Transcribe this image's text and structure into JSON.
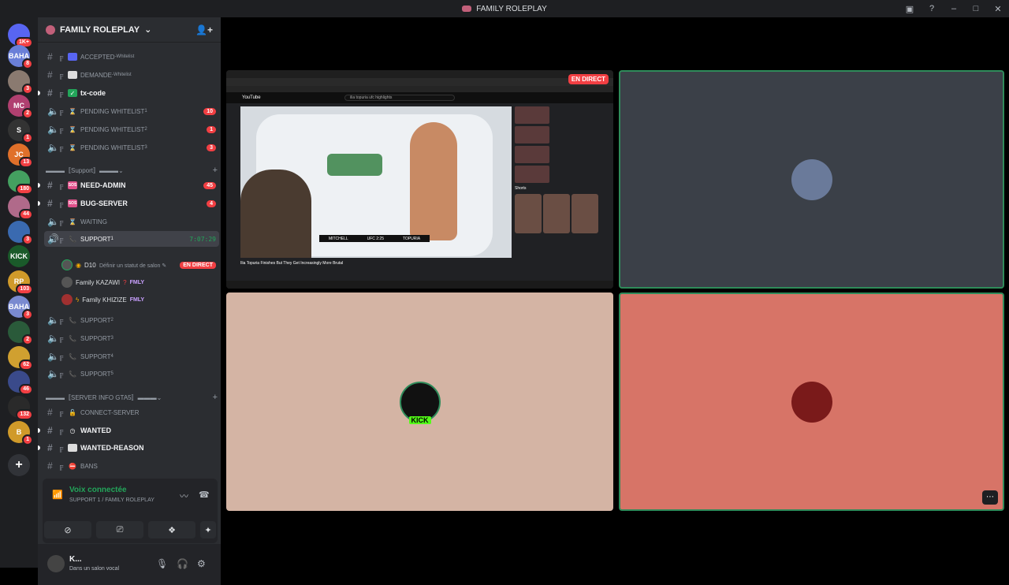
{
  "window": {
    "title": "FAMILY ROLEPLAY"
  },
  "servers": [
    {
      "badge": "1K+",
      "color": "#5865f2",
      "label": ""
    },
    {
      "badge": "8",
      "color": "#6a7fd8",
      "label": "BAHA"
    },
    {
      "badge": "3",
      "color": "#8a7a70",
      "label": ""
    },
    {
      "badge": "2",
      "color": "#b04070",
      "label": "MC"
    },
    {
      "badge": "1",
      "color": "#333",
      "label": "S"
    },
    {
      "badge": "13",
      "color": "#e0702a",
      "label": "JC"
    },
    {
      "badge": "180",
      "color": "#44a060",
      "label": ""
    },
    {
      "badge": "44",
      "color": "#b06a8a",
      "label": ""
    },
    {
      "badge": "3",
      "color": "#3a6ab0",
      "label": ""
    },
    {
      "badge": "",
      "color": "#1a5a2a",
      "label": "KICK"
    },
    {
      "badge": "103",
      "color": "#d09a2a",
      "label": "RP"
    },
    {
      "badge": "3",
      "color": "#7a8ad0",
      "label": "BAHA"
    },
    {
      "badge": "2",
      "color": "#2a5a3a",
      "label": ""
    },
    {
      "badge": "62",
      "color": "#d0a030",
      "label": ""
    },
    {
      "badge": "46",
      "color": "#3a4a8a",
      "label": ""
    },
    {
      "badge": "132",
      "color": "#2a2a2a",
      "label": ""
    },
    {
      "badge": "1",
      "color": "#d09a2a",
      "label": "B"
    }
  ],
  "guild": {
    "name": "FAMILY ROLEPLAY"
  },
  "channels": {
    "accepted": {
      "label": "ACCEPTED",
      "sup": "-Whitelist"
    },
    "demande": {
      "label": "DEMANDE",
      "sup": "-Whitelist"
    },
    "txcode": {
      "label": "tx-code"
    },
    "pending1": {
      "label": "PENDING WHITELIST",
      "sup": "1",
      "badge": "10"
    },
    "pending2": {
      "label": "PENDING WHITELIST",
      "sup": "2",
      "badge": "1"
    },
    "pending3": {
      "label": "PENDING WHITELIST",
      "sup": "3",
      "badge": "3"
    },
    "cat_support": "▬▬▬〚Support〛▬▬▬",
    "needadmin": {
      "label": "NEED-ADMIN",
      "badge": "45"
    },
    "bugserver": {
      "label": "BUG-SERVER",
      "badge": "4"
    },
    "waiting": {
      "label": "WAITING"
    },
    "support1": {
      "label": "SUPPORT",
      "sup": "1",
      "timer": "7:07:29"
    },
    "status_hint": "Définir un statut de salon",
    "support2": {
      "label": "SUPPORT",
      "sup": "2"
    },
    "support3": {
      "label": "SUPPORT",
      "sup": "3"
    },
    "support4": {
      "label": "SUPPORT",
      "sup": "4"
    },
    "support5": {
      "label": "SUPPORT",
      "sup": "5"
    },
    "cat_info": "▬▬▬〚SERVER INFO GTA5〛▬▬▬",
    "connect": {
      "label": "CONNECT-SERVER"
    },
    "wanted": {
      "label": "WANTED"
    },
    "wanted_reason": {
      "label": "WANTED-REASON"
    },
    "bans": {
      "label": "BANS"
    }
  },
  "voice_users": [
    {
      "name": "D10",
      "extra": "",
      "live": "EN DIRECT"
    },
    {
      "name": "Family KAZAWI",
      "extra": "FMLY",
      "live": ""
    },
    {
      "name": "Family KHIZIZE",
      "extra": "FMLY",
      "live": ""
    }
  ],
  "voice_panel": {
    "title": "Voix connectée",
    "sub": "SUPPORT 1 / FAMILY ROLEPLAY"
  },
  "user": {
    "name": "K...",
    "status": "Dans un salon vocal"
  },
  "stream": {
    "live_label": "EN DIRECT",
    "yt_brand": "YouTube",
    "search": "ilia topuria ufc highlights",
    "video_title": "Ilia Topuria Finishes But They Get Increasingly More Brutal",
    "score_left": "MITCHELL",
    "score_mid": "UFC 2:25",
    "score_right": "TOPURIA",
    "shorts_label": "Shorts"
  }
}
